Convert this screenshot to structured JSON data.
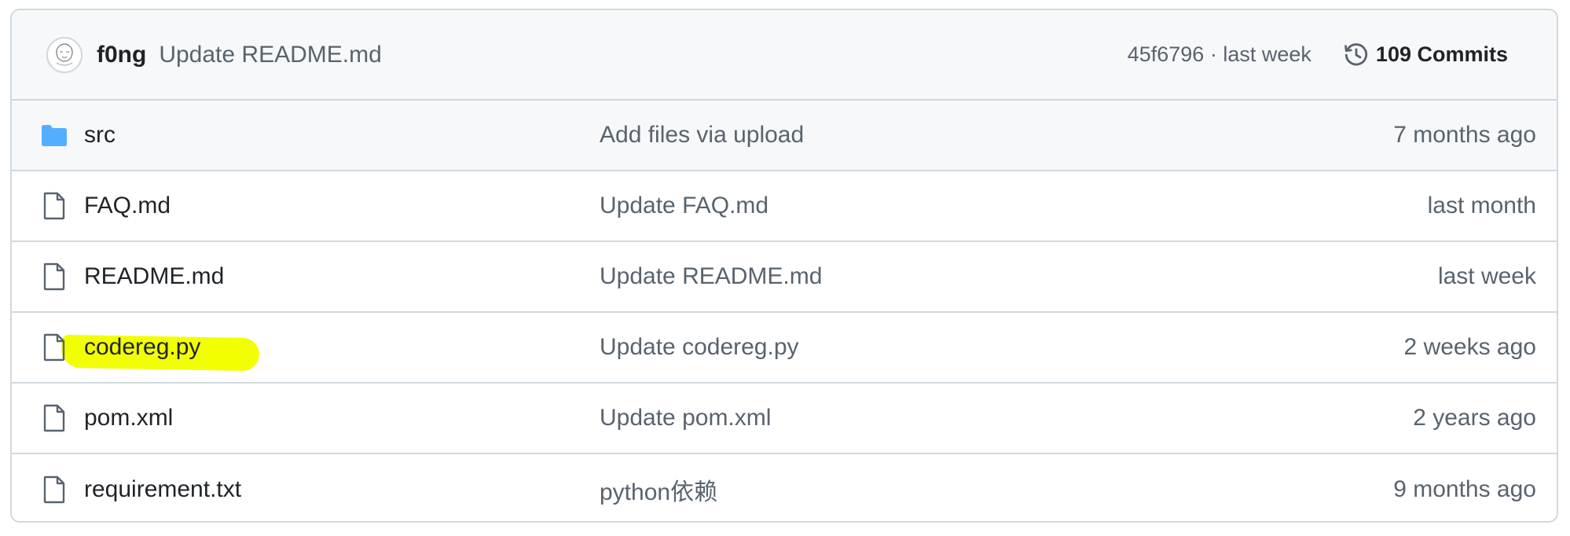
{
  "latest_commit": {
    "author": "f0ng",
    "message": "Update README.md",
    "hash": "45f6796",
    "separator": "·",
    "time": "last week",
    "commits_label": "109 Commits"
  },
  "files": [
    {
      "type": "folder",
      "icon": "folder-icon",
      "name": "src",
      "message": "Add files via upload",
      "age": "7 months ago"
    },
    {
      "type": "file",
      "icon": "file-icon",
      "name": "FAQ.md",
      "message": "Update FAQ.md",
      "age": "last month"
    },
    {
      "type": "file",
      "icon": "file-icon",
      "name": "README.md",
      "message": "Update README.md",
      "age": "last week"
    },
    {
      "type": "file",
      "icon": "file-icon",
      "name": "codereg.py",
      "message": "Update codereg.py",
      "age": "2 weeks ago",
      "highlighted": true
    },
    {
      "type": "file",
      "icon": "file-icon",
      "name": "pom.xml",
      "message": "Update pom.xml",
      "age": "2 years ago"
    },
    {
      "type": "file",
      "icon": "file-icon",
      "name": "requirement.txt",
      "message": "python依赖",
      "age": "9 months ago"
    }
  ],
  "colors": {
    "folder": "#54aeff",
    "highlight": "#f2ff00",
    "muted_text": "#59636e",
    "border": "#d1d9e0"
  }
}
